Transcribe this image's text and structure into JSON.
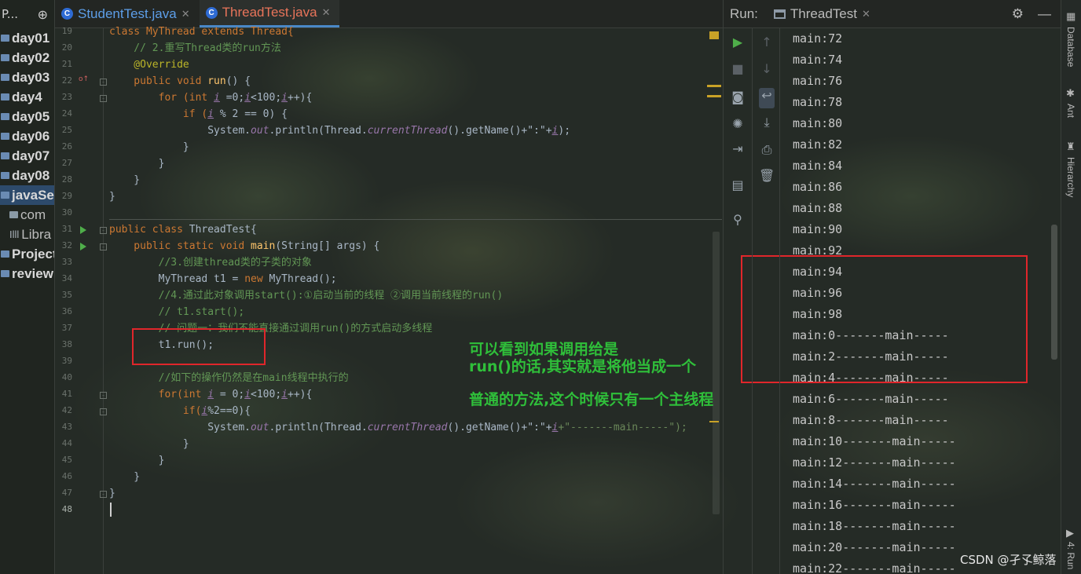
{
  "sidebar": {
    "header": "P...",
    "items": [
      "day01",
      "day02",
      "day03",
      "day4",
      "day05",
      "day06",
      "day07",
      "day08",
      "javaSer",
      "com",
      "Libra",
      "Project",
      "reviewl"
    ]
  },
  "tabs": [
    {
      "label": "StudentTest.java"
    },
    {
      "label": "ThreadTest.java"
    }
  ],
  "editor": {
    "line_numbers": [
      "19",
      "20",
      "21",
      "22",
      "23",
      "24",
      "25",
      "26",
      "27",
      "28",
      "29",
      "30",
      "31",
      "32",
      "33",
      "34",
      "35",
      "36",
      "37",
      "38",
      "39",
      "40",
      "41",
      "42",
      "43",
      "44",
      "45",
      "46",
      "47",
      "48"
    ],
    "lines": {
      "l19": "class MyThread extends Thread{",
      "l20": "    // 2.重写Thread类的run方法",
      "l21": "    @Override",
      "l22a": "    public void ",
      "l22b": "run",
      "l22c": "() {",
      "l23a": "        for (int ",
      "l23b": "i",
      "l23c": " =0;",
      "l23d": "i",
      "l23e": "<100;",
      "l23f": "i",
      "l23g": "++){",
      "l24a": "            if (",
      "l24b": "i",
      "l24c": " % 2 == 0) {",
      "l25a": "                System.",
      "l25b": "out",
      "l25c": ".println(Thread.",
      "l25d": "currentThread",
      "l25e": "().getName()+\":\"+",
      "l25f": "i",
      "l25g": ");",
      "l26": "            }",
      "l27": "        }",
      "l28": "    }",
      "l29": "}",
      "l31a": "public class ",
      "l31b": "ThreadTest{",
      "l32a": "    public static void ",
      "l32b": "main",
      "l32c": "(String[] args) {",
      "l33": "        //3.创建thread类的子类的对象",
      "l34a": "        MyThread t1 = ",
      "l34b": "new",
      "l34c": " MyThread();",
      "l35": "        //4.通过此对象调用start():①启动当前的线程 ②调用当前线程的run()",
      "l36": "        // t1.start();",
      "l37": "        // 问题一：我们不能直接通过调用run()的方式启动多线程",
      "l38": "        t1.run();",
      "l40": "        //如下的操作仍然是在main线程中执行的",
      "l41a": "        for(int ",
      "l41b": "i",
      "l41c": " = 0;",
      "l41d": "i",
      "l41e": "<100;",
      "l41f": "i",
      "l41g": "++){",
      "l42a": "            if(",
      "l42b": "i",
      "l42c": "%2==0){",
      "l43a": "                System.",
      "l43b": "out",
      "l43c": ".println(Thread.",
      "l43d": "currentThread",
      "l43e": "().getName()+\":\"+",
      "l43f": "i",
      "l43g": "+\"-------main-----\");",
      "l44": "            }",
      "l45": "        }",
      "l46": "    }",
      "l47": "}"
    }
  },
  "annotation": {
    "line1": "可以看到如果调用给是",
    "line2": "run()的话,其实就是将他当成一个",
    "line3": "普通的方法,这个时候只有一个主线程"
  },
  "run_panel": {
    "label": "Run:",
    "tab": "ThreadTest",
    "output": [
      "main:72",
      "main:74",
      "main:76",
      "main:78",
      "main:80",
      "main:82",
      "main:84",
      "main:86",
      "main:88",
      "main:90",
      "main:92",
      "main:94",
      "main:96",
      "main:98",
      "main:0-------main-----",
      "main:2-------main-----",
      "main:4-------main-----",
      "main:6-------main-----",
      "main:8-------main-----",
      "main:10-------main-----",
      "main:12-------main-----",
      "main:14-------main-----",
      "main:16-------main-----",
      "main:18-------main-----",
      "main:20-------main-----",
      "main:22-------main-----"
    ]
  },
  "right_strip": {
    "database": "Database",
    "ant": "Ant",
    "hierarchy": "Hierarchy",
    "run": "4: Run"
  },
  "watermark": "CSDN @孑孓鲸落",
  "colors": {
    "keyword": "#cc7832",
    "comment": "#629755",
    "annotation_text": "#2fbf3a",
    "highlight_box": "#e0262b"
  }
}
